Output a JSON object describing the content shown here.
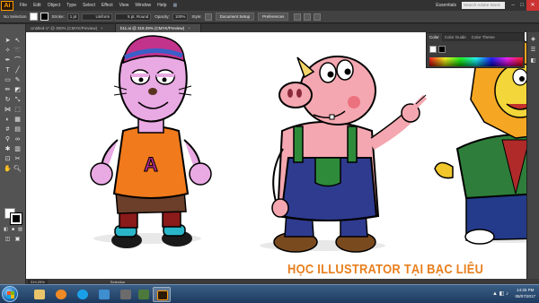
{
  "menubar": {
    "logo": "Ai",
    "items": [
      "File",
      "Edit",
      "Object",
      "Type",
      "Select",
      "Effect",
      "View",
      "Window",
      "Help"
    ],
    "workspace": "Essentials",
    "search_placeholder": "Search Adobe Stock",
    "win_controls": [
      "–",
      "□",
      "✕"
    ]
  },
  "controlbar": {
    "selection_label": "No Selection",
    "stroke_label": "Stroke:",
    "stroke_value": "1 pt",
    "profile_value": "Uniform",
    "brush_value": "5 pt. Round",
    "opacity_label": "Opacity:",
    "opacity_value": "100%",
    "style_label": "Style:",
    "document_setup": "Document Setup",
    "preferences": "Preferences",
    "fill_color": "#ffffff",
    "stroke_color": "#000000"
  },
  "tabs": [
    {
      "label": "Untitled-1* @ 300% (CMYK/Preview)",
      "active": false
    },
    {
      "label": "b11.ai @ 319.29% (CMYK/Preview)",
      "active": true
    }
  ],
  "color_panel": {
    "tabs": [
      "Color",
      "Color Guide",
      "Color Theme"
    ],
    "active_tab": "Color"
  },
  "statusbar": {
    "zoom": "319.29%",
    "tool": "Selection"
  },
  "watermark": "HỌC ILLUSTRATOR TẠI BẠC LIÊU",
  "taskbar": {
    "time": "14:25 PM",
    "date": "08/07/2017"
  },
  "colors": {
    "accent": "#ff9a00",
    "watermark": "#e87f1e"
  }
}
